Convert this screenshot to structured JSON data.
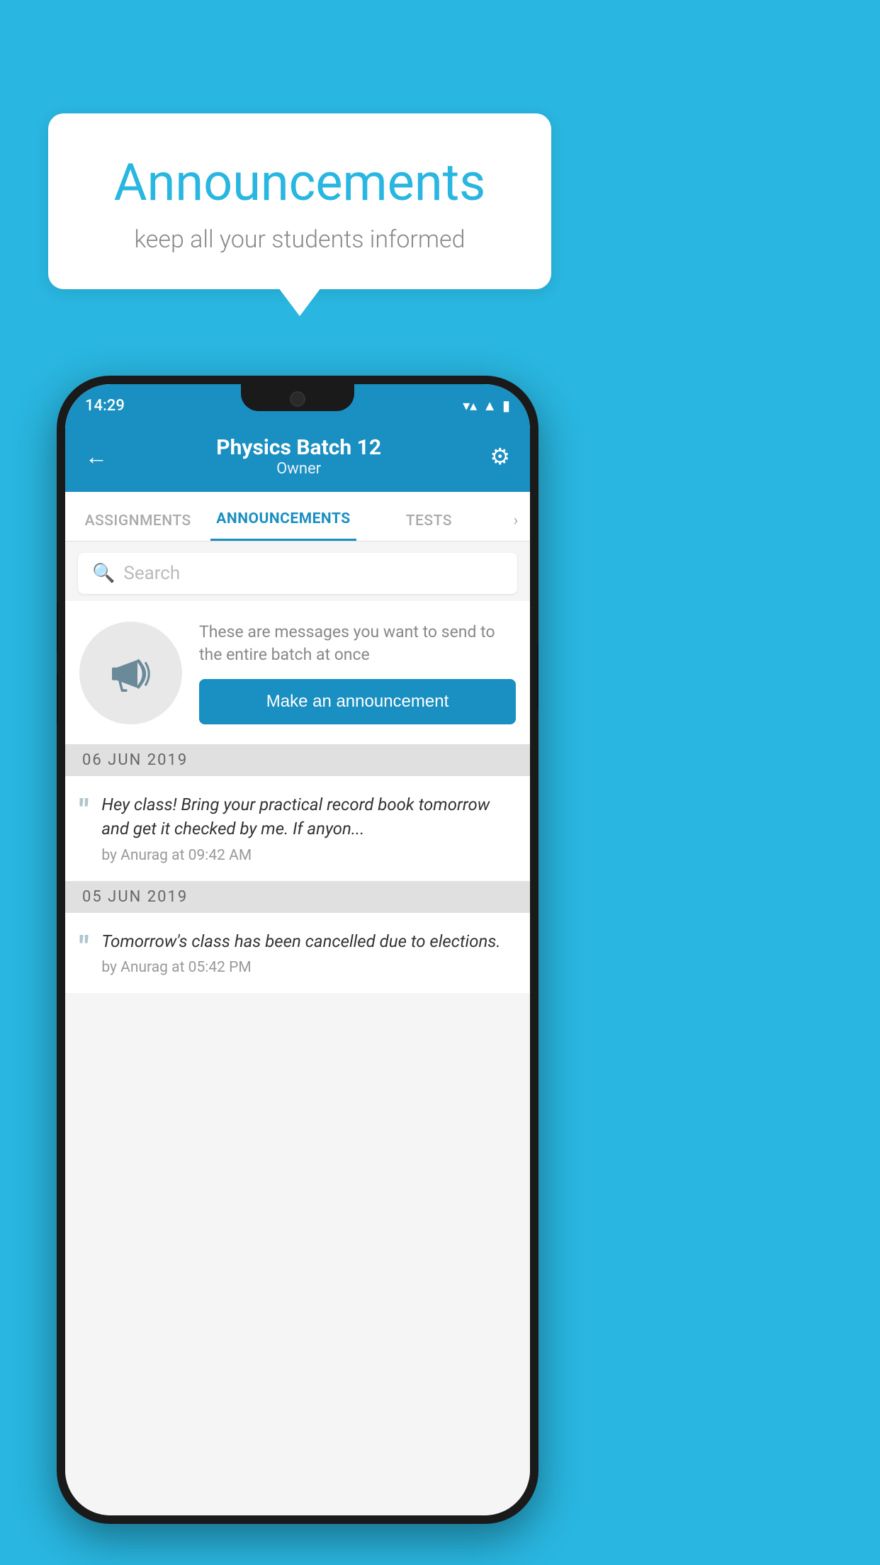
{
  "background_color": "#29b6e0",
  "speech_bubble": {
    "title": "Announcements",
    "subtitle": "keep all your students informed"
  },
  "phone": {
    "status_bar": {
      "time": "14:29",
      "icons": [
        "wifi",
        "signal",
        "battery"
      ]
    },
    "app_bar": {
      "title": "Physics Batch 12",
      "subtitle": "Owner",
      "back_label": "←",
      "settings_label": "⚙"
    },
    "tabs": [
      {
        "label": "ASSIGNMENTS",
        "active": false
      },
      {
        "label": "ANNOUNCEMENTS",
        "active": true
      },
      {
        "label": "TESTS",
        "active": false
      }
    ],
    "search": {
      "placeholder": "Search"
    },
    "announcement_cta": {
      "description": "These are messages you want to send to the entire batch at once",
      "button_label": "Make an announcement"
    },
    "announcements": [
      {
        "date": "06  JUN  2019",
        "message": "Hey class! Bring your practical record book tomorrow and get it checked by me. If anyon...",
        "meta": "by Anurag at 09:42 AM"
      },
      {
        "date": "05  JUN  2019",
        "message": "Tomorrow's class has been cancelled due to elections.",
        "meta": "by Anurag at 05:42 PM"
      }
    ]
  }
}
